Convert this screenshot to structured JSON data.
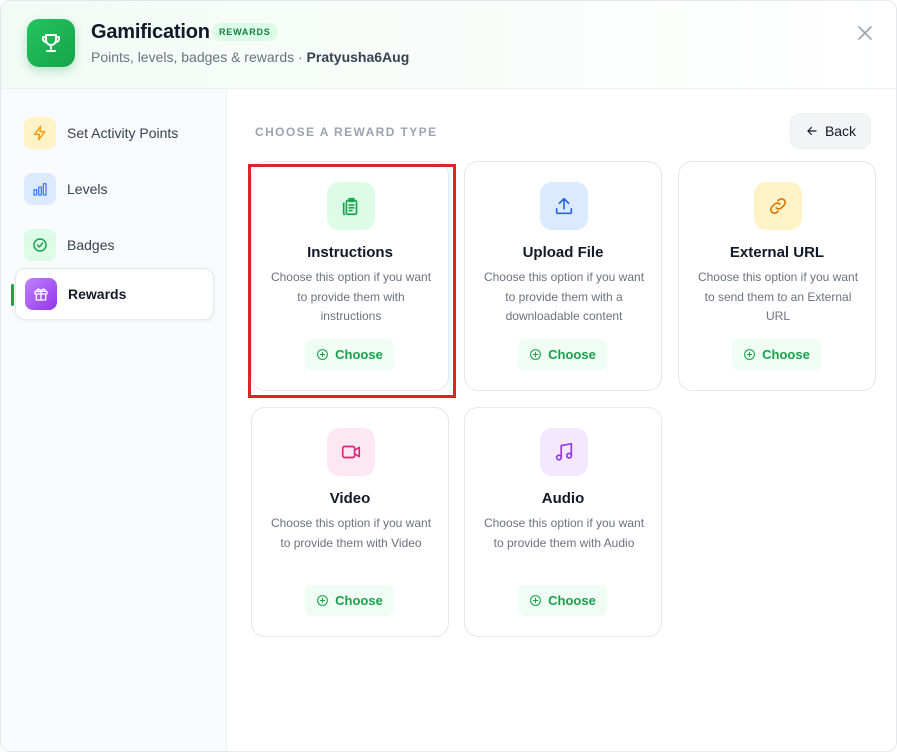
{
  "header": {
    "title": "Gamification",
    "badge": "REWARDS",
    "subtitle": "Points, levels, badges & rewards · ",
    "user": "Pratyusha6Aug",
    "icons": {
      "app": "trophy-icon",
      "close": "close-icon"
    }
  },
  "sidebar": {
    "items": [
      {
        "label": "Set Activity Points",
        "icon": "lightning-icon",
        "color": "#f59e0b",
        "bg": "#fef3c7"
      },
      {
        "label": "Levels",
        "icon": "bar-chart-icon",
        "color": "#3b82f6",
        "bg": "#dbeafe"
      },
      {
        "label": "Badges",
        "icon": "check-circle-icon",
        "color": "#16a34a",
        "bg": "#dcfce7"
      },
      {
        "label": "Rewards",
        "icon": "gift-icon",
        "color": "#ffffff",
        "bg": "#a855f7",
        "active": true
      }
    ]
  },
  "main": {
    "section_label": "CHOOSE A REWARD TYPE",
    "back_label": "Back",
    "choose_label": "Choose",
    "cards": [
      {
        "title": "Instructions",
        "desc": "Choose this option if you want to provide them with instructions",
        "icon": "clipboard-icon",
        "color": "#16a34a",
        "bg": "#dcfce7"
      },
      {
        "title": "Upload File",
        "desc": "Choose this option if you want to provide them with a downloadable content",
        "icon": "upload-icon",
        "color": "#2563eb",
        "bg": "#dbeafe"
      },
      {
        "title": "External URL",
        "desc": "Choose this option if you want to send them to an External URL",
        "icon": "link-icon",
        "color": "#d97706",
        "bg": "#fef3c7"
      },
      {
        "title": "Video",
        "desc": "Choose this option if you want to provide them with Video",
        "icon": "video-icon",
        "color": "#db2777",
        "bg": "#fce7f3"
      },
      {
        "title": "Audio",
        "desc": "Choose this option if you want to provide them with Audio",
        "icon": "music-icon",
        "color": "#9333ea",
        "bg": "#f3e8ff"
      }
    ]
  },
  "colors": {
    "accent": "#16a34a",
    "highlight": "#dc2626"
  }
}
